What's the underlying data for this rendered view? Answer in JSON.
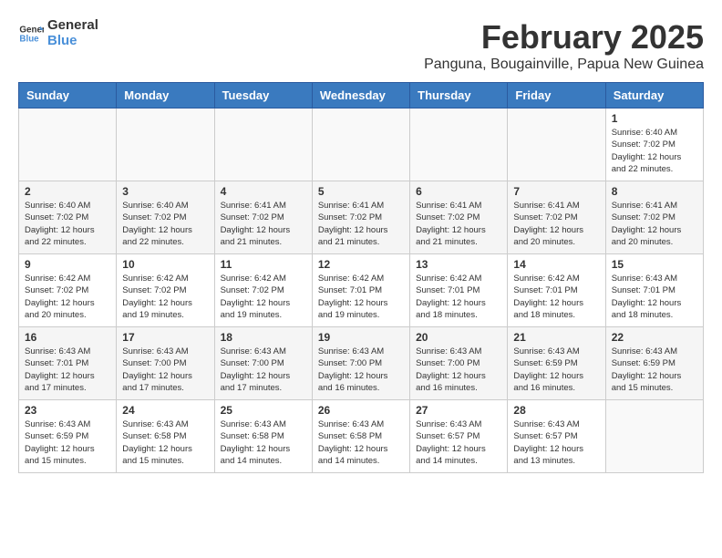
{
  "logo": {
    "line1": "General",
    "line2": "Blue"
  },
  "title": "February 2025",
  "subtitle": "Panguna, Bougainville, Papua New Guinea",
  "weekdays": [
    "Sunday",
    "Monday",
    "Tuesday",
    "Wednesday",
    "Thursday",
    "Friday",
    "Saturday"
  ],
  "weeks": [
    [
      {
        "day": "",
        "info": ""
      },
      {
        "day": "",
        "info": ""
      },
      {
        "day": "",
        "info": ""
      },
      {
        "day": "",
        "info": ""
      },
      {
        "day": "",
        "info": ""
      },
      {
        "day": "",
        "info": ""
      },
      {
        "day": "1",
        "info": "Sunrise: 6:40 AM\nSunset: 7:02 PM\nDaylight: 12 hours\nand 22 minutes."
      }
    ],
    [
      {
        "day": "2",
        "info": "Sunrise: 6:40 AM\nSunset: 7:02 PM\nDaylight: 12 hours\nand 22 minutes."
      },
      {
        "day": "3",
        "info": "Sunrise: 6:40 AM\nSunset: 7:02 PM\nDaylight: 12 hours\nand 22 minutes."
      },
      {
        "day": "4",
        "info": "Sunrise: 6:41 AM\nSunset: 7:02 PM\nDaylight: 12 hours\nand 21 minutes."
      },
      {
        "day": "5",
        "info": "Sunrise: 6:41 AM\nSunset: 7:02 PM\nDaylight: 12 hours\nand 21 minutes."
      },
      {
        "day": "6",
        "info": "Sunrise: 6:41 AM\nSunset: 7:02 PM\nDaylight: 12 hours\nand 21 minutes."
      },
      {
        "day": "7",
        "info": "Sunrise: 6:41 AM\nSunset: 7:02 PM\nDaylight: 12 hours\nand 20 minutes."
      },
      {
        "day": "8",
        "info": "Sunrise: 6:41 AM\nSunset: 7:02 PM\nDaylight: 12 hours\nand 20 minutes."
      }
    ],
    [
      {
        "day": "9",
        "info": "Sunrise: 6:42 AM\nSunset: 7:02 PM\nDaylight: 12 hours\nand 20 minutes."
      },
      {
        "day": "10",
        "info": "Sunrise: 6:42 AM\nSunset: 7:02 PM\nDaylight: 12 hours\nand 19 minutes."
      },
      {
        "day": "11",
        "info": "Sunrise: 6:42 AM\nSunset: 7:02 PM\nDaylight: 12 hours\nand 19 minutes."
      },
      {
        "day": "12",
        "info": "Sunrise: 6:42 AM\nSunset: 7:01 PM\nDaylight: 12 hours\nand 19 minutes."
      },
      {
        "day": "13",
        "info": "Sunrise: 6:42 AM\nSunset: 7:01 PM\nDaylight: 12 hours\nand 18 minutes."
      },
      {
        "day": "14",
        "info": "Sunrise: 6:42 AM\nSunset: 7:01 PM\nDaylight: 12 hours\nand 18 minutes."
      },
      {
        "day": "15",
        "info": "Sunrise: 6:43 AM\nSunset: 7:01 PM\nDaylight: 12 hours\nand 18 minutes."
      }
    ],
    [
      {
        "day": "16",
        "info": "Sunrise: 6:43 AM\nSunset: 7:01 PM\nDaylight: 12 hours\nand 17 minutes."
      },
      {
        "day": "17",
        "info": "Sunrise: 6:43 AM\nSunset: 7:00 PM\nDaylight: 12 hours\nand 17 minutes."
      },
      {
        "day": "18",
        "info": "Sunrise: 6:43 AM\nSunset: 7:00 PM\nDaylight: 12 hours\nand 17 minutes."
      },
      {
        "day": "19",
        "info": "Sunrise: 6:43 AM\nSunset: 7:00 PM\nDaylight: 12 hours\nand 16 minutes."
      },
      {
        "day": "20",
        "info": "Sunrise: 6:43 AM\nSunset: 7:00 PM\nDaylight: 12 hours\nand 16 minutes."
      },
      {
        "day": "21",
        "info": "Sunrise: 6:43 AM\nSunset: 6:59 PM\nDaylight: 12 hours\nand 16 minutes."
      },
      {
        "day": "22",
        "info": "Sunrise: 6:43 AM\nSunset: 6:59 PM\nDaylight: 12 hours\nand 15 minutes."
      }
    ],
    [
      {
        "day": "23",
        "info": "Sunrise: 6:43 AM\nSunset: 6:59 PM\nDaylight: 12 hours\nand 15 minutes."
      },
      {
        "day": "24",
        "info": "Sunrise: 6:43 AM\nSunset: 6:58 PM\nDaylight: 12 hours\nand 15 minutes."
      },
      {
        "day": "25",
        "info": "Sunrise: 6:43 AM\nSunset: 6:58 PM\nDaylight: 12 hours\nand 14 minutes."
      },
      {
        "day": "26",
        "info": "Sunrise: 6:43 AM\nSunset: 6:58 PM\nDaylight: 12 hours\nand 14 minutes."
      },
      {
        "day": "27",
        "info": "Sunrise: 6:43 AM\nSunset: 6:57 PM\nDaylight: 12 hours\nand 14 minutes."
      },
      {
        "day": "28",
        "info": "Sunrise: 6:43 AM\nSunset: 6:57 PM\nDaylight: 12 hours\nand 13 minutes."
      },
      {
        "day": "",
        "info": ""
      }
    ]
  ]
}
